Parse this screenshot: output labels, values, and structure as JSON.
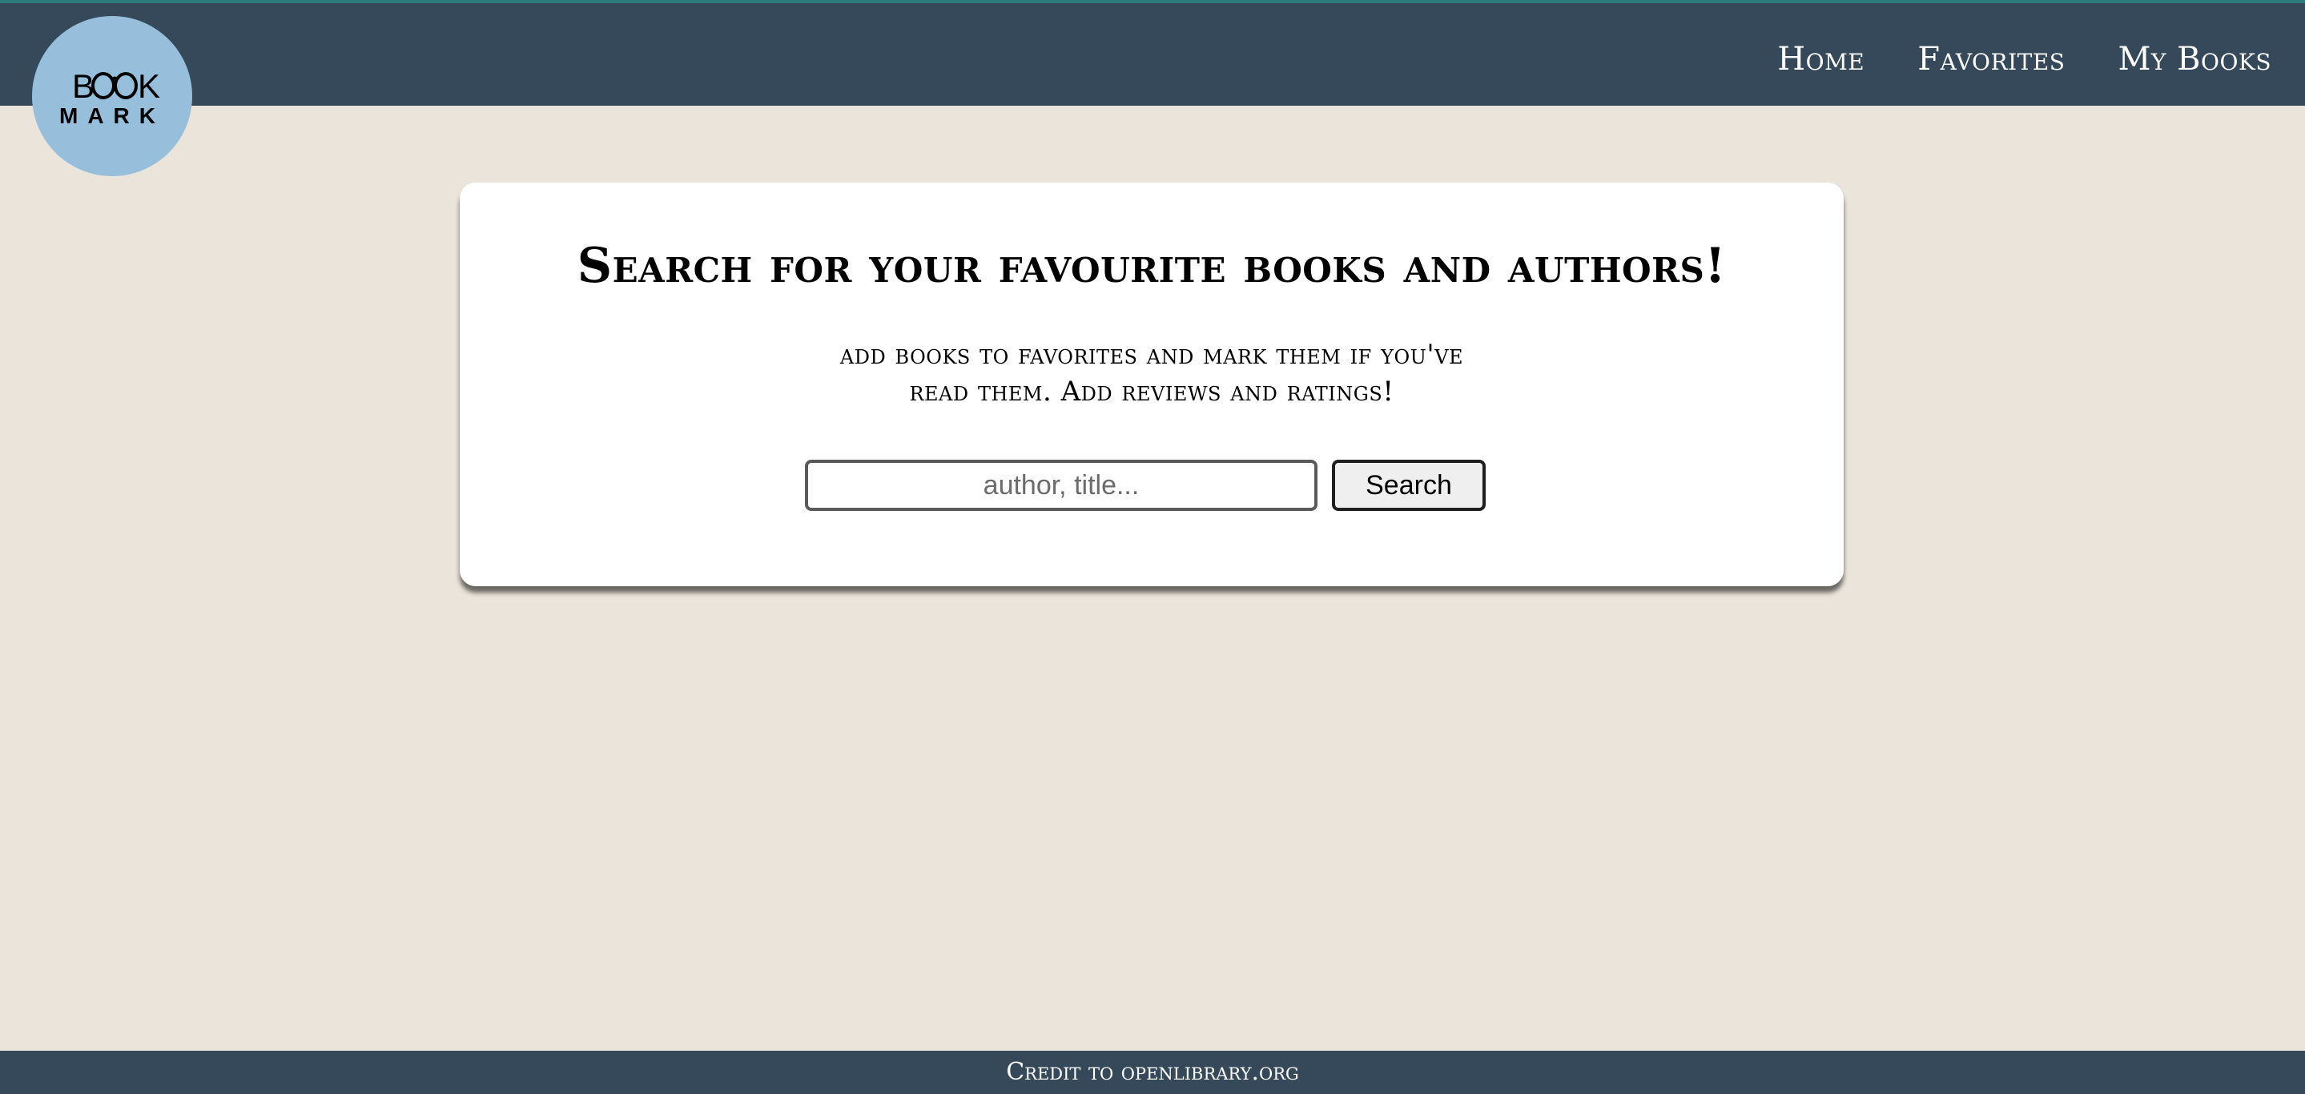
{
  "logo": {
    "top_text": "BOOK",
    "bottom_text": "MARK",
    "icon": "eyeglasses-icon",
    "color": "#97bfdc"
  },
  "nav": {
    "items": [
      {
        "label": "Home"
      },
      {
        "label": "Favorites"
      },
      {
        "label": "My Books"
      }
    ]
  },
  "hero": {
    "title": "Search for your favourite books and authors!",
    "subtitle_line1": "add books to favorites and mark them if you've",
    "subtitle_line2": "read them. Add reviews and ratings!"
  },
  "search": {
    "value": "",
    "placeholder": "author, title...",
    "button_label": "Search"
  },
  "footer": {
    "credit": "Credit to openlibrary.org"
  },
  "colors": {
    "header_bg": "#35495b",
    "page_bg": "#ebe4da",
    "card_bg": "#ffffff"
  }
}
